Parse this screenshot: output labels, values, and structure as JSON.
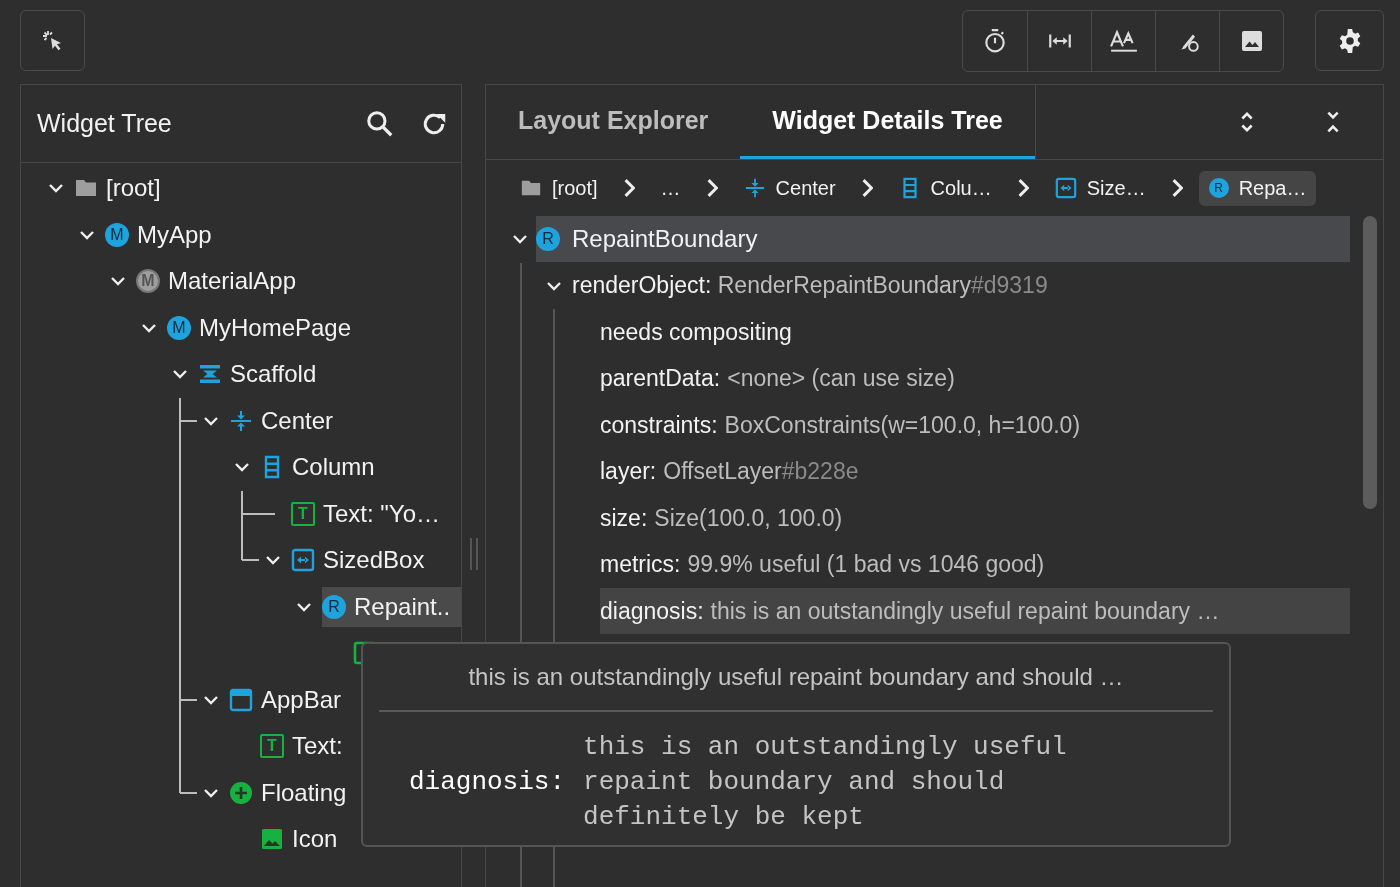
{
  "widget_tree": {
    "title": "Widget Tree",
    "nodes": [
      {
        "label": "[root]",
        "kind": "folder",
        "expanded": true,
        "selected": false,
        "children": [
          {
            "label": "MyApp",
            "kind": "stateless",
            "badge": "M",
            "expanded": true,
            "selected": false,
            "children": [
              {
                "label": "MaterialApp",
                "kind": "material",
                "badge": "M",
                "expanded": true,
                "selected": false,
                "children": [
                  {
                    "label": "MyHomePage",
                    "kind": "stateless",
                    "badge": "M",
                    "expanded": true,
                    "selected": false,
                    "children": [
                      {
                        "label": "Scaffold",
                        "kind": "scaffold",
                        "expanded": true,
                        "selected": false,
                        "children": [
                          {
                            "label": "Center",
                            "kind": "center",
                            "expanded": true,
                            "selected": false,
                            "children": [
                              {
                                "label": "Column",
                                "kind": "column",
                                "expanded": true,
                                "selected": false,
                                "children": [
                                  {
                                    "label": "Text: \"Yo…",
                                    "kind": "text",
                                    "badge": "T",
                                    "selected": false
                                  },
                                  {
                                    "label": "SizedBox",
                                    "kind": "sizedbox",
                                    "expanded": true,
                                    "selected": false,
                                    "children": [
                                      {
                                        "label": "Repaint..",
                                        "kind": "repaint",
                                        "badge": "R",
                                        "expanded": true,
                                        "selected": true,
                                        "children": [
                                          {
                                            "kind": "text",
                                            "selected": false
                                          }
                                        ]
                                      }
                                    ]
                                  }
                                ]
                              }
                            ]
                          },
                          {
                            "label": "AppBar",
                            "kind": "appbar",
                            "expanded": true,
                            "selected": false,
                            "children": [
                              {
                                "label": "Text:",
                                "kind": "text",
                                "badge": "T",
                                "selected": false
                              }
                            ]
                          },
                          {
                            "label": "Floating",
                            "kind": "fab",
                            "expanded": true,
                            "selected": false,
                            "children": [
                              {
                                "label": "Icon",
                                "kind": "image",
                                "selected": false
                              }
                            ]
                          }
                        ]
                      }
                    ]
                  }
                ]
              }
            ]
          }
        ]
      }
    ]
  },
  "details_panel": {
    "tabs": [
      {
        "label": "Layout Explorer",
        "selected": false
      },
      {
        "label": "Widget Details Tree",
        "selected": true
      }
    ],
    "breadcrumbs": [
      {
        "label": "[root]",
        "kind": "folder",
        "selected": false
      },
      {
        "label": "…",
        "selected": false
      },
      {
        "label": "Center",
        "kind": "center",
        "selected": false
      },
      {
        "label": "Colu…",
        "kind": "column",
        "selected": false
      },
      {
        "label": "Size…",
        "kind": "sizedbox",
        "selected": false
      },
      {
        "label": "Repa…",
        "kind": "repaint",
        "badge": "R",
        "selected": true
      }
    ],
    "root": {
      "label": "RepaintBoundary",
      "kind": "repaint",
      "badge": "R",
      "expanded": true,
      "selected": true
    },
    "render_object": {
      "name": "renderObject:",
      "value": "RenderRepaintBoundary",
      "hash": "#d9319",
      "expanded": true
    },
    "properties": [
      {
        "name": "needs compositing",
        "selected": false
      },
      {
        "name": "parentData:",
        "value": "<none> (can use size)",
        "selected": false
      },
      {
        "name": "constraints:",
        "value": "BoxConstraints(w=100.0, h=100.0)",
        "selected": false
      },
      {
        "name": "layer:",
        "value": "OffsetLayer",
        "hash": "#b228e",
        "selected": false
      },
      {
        "name": "size:",
        "value": "Size(100.0, 100.0)",
        "selected": false
      },
      {
        "name": "metrics:",
        "value": "99.9% useful (1 bad vs 1046 good)",
        "selected": false
      },
      {
        "name": "diagnosis:",
        "value": "this is an outstandingly useful repaint boundary …",
        "selected": true
      }
    ]
  },
  "tooltip": {
    "summary": "this is an outstandingly useful repaint boundary and should …",
    "name": "diagnosis:",
    "value": "this is an outstandingly useful repaint boundary and should definitely be kept"
  }
}
